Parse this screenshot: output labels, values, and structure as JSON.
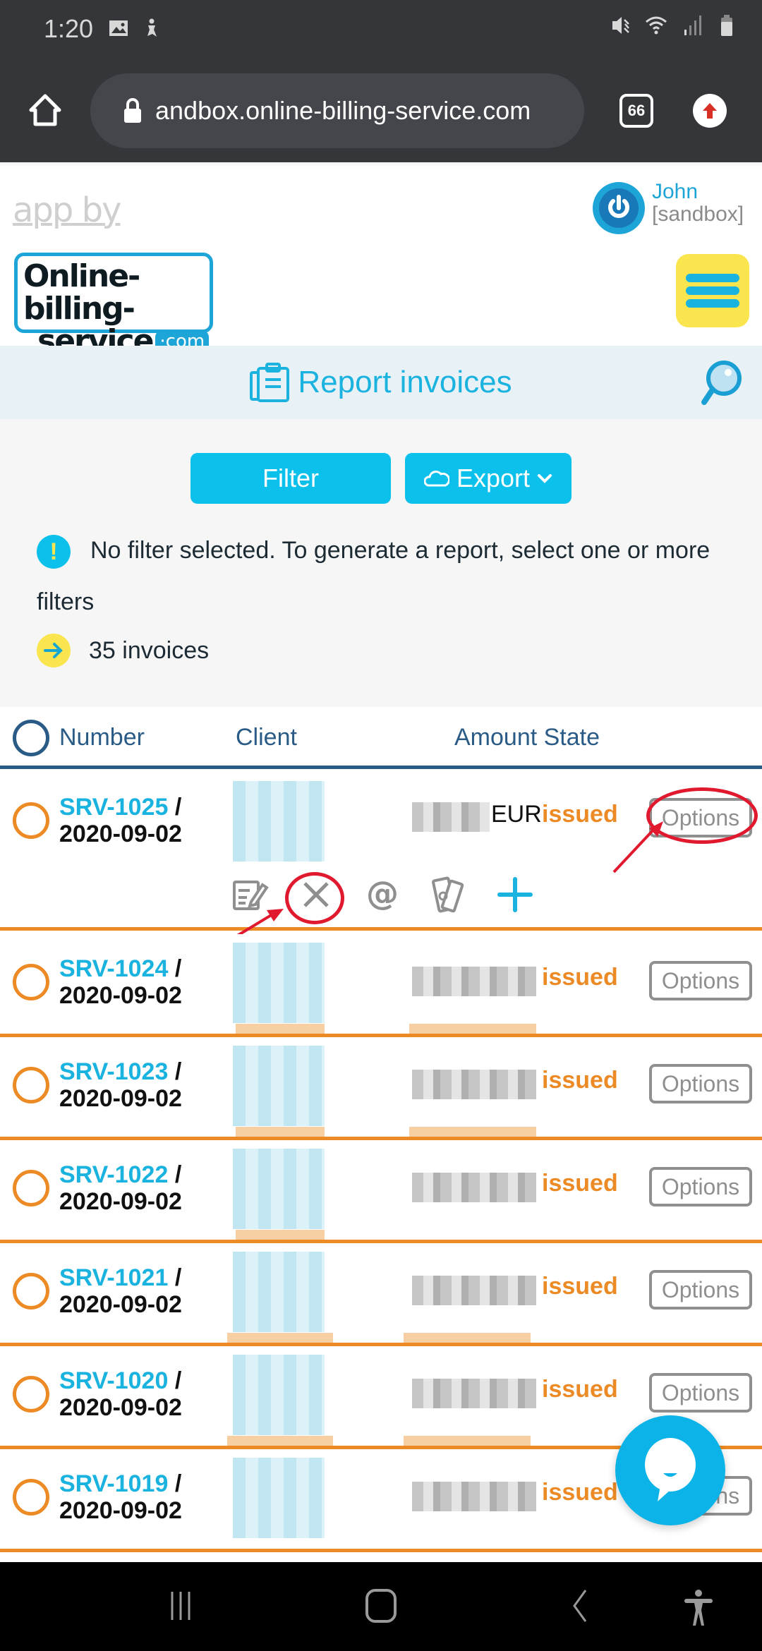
{
  "status_bar": {
    "time": "1:20",
    "left_icons": [
      "image-icon",
      "accessibility-notification-icon"
    ],
    "right_icons": [
      "vibrate-mute-icon",
      "wifi-icon",
      "signal-icon",
      "battery-icon"
    ]
  },
  "browser": {
    "url": "andbox.online-billing-service.com",
    "tab_count": "66",
    "home_icon": "home-icon",
    "lock_icon": "lock-icon",
    "update_icon": "update-arrow-icon"
  },
  "header": {
    "app_by": "app by",
    "logo_line1": "Online-billing-",
    "logo_line2": "service",
    "logo_com": "·com",
    "user_name": "John",
    "user_sub": "[sandbox]",
    "menu_icon": "hamburger-menu-icon"
  },
  "page": {
    "title": "Report invoices",
    "title_icon": "clipboard-icon",
    "search_icon": "search-icon"
  },
  "filters": {
    "filter_label": "Filter",
    "export_label": "Export",
    "notice_first": "No filter selected. To generate a report, select one or more",
    "notice_second": "filters",
    "count_text": "35 invoices"
  },
  "table": {
    "headers": {
      "number": "Number",
      "client": "Client",
      "amount_state": "Amount State"
    },
    "rows": [
      {
        "number": "SRV-1025",
        "sep": " /",
        "date": "2020-09-02",
        "currency": "EUR",
        "state": "issued",
        "options": "Options"
      },
      {
        "number": "SRV-1024",
        "sep": " /",
        "date": "2020-09-02",
        "currency": "",
        "state": "issued",
        "options": "Options"
      },
      {
        "number": "SRV-1023",
        "sep": " /",
        "date": "2020-09-02",
        "currency": "",
        "state": "issued",
        "options": "Options"
      },
      {
        "number": "SRV-1022",
        "sep": " /",
        "date": "2020-09-02",
        "currency": "",
        "state": "issued",
        "options": "Options"
      },
      {
        "number": "SRV-1021",
        "sep": " /",
        "date": "2020-09-02",
        "currency": "",
        "state": "issued",
        "options": "Options"
      },
      {
        "number": "SRV-1020",
        "sep": " /",
        "date": "2020-09-02",
        "currency": "",
        "state": "issued",
        "options": "Options"
      },
      {
        "number": "SRV-1019",
        "sep": " /",
        "date": "2020-09-02",
        "currency": "",
        "state": "issued",
        "options": "Options"
      }
    ],
    "row_actions": [
      "edit-icon",
      "cancel-icon",
      "email-icon",
      "payment-icon",
      "add-icon"
    ]
  },
  "colors": {
    "accent_blue": "#1ab3e0",
    "button_blue": "#0bc0ea",
    "header_navy": "#2a5b86",
    "state_orange": "#ec8a25",
    "menu_yellow": "#fbe54f",
    "annotation_red": "#e0192f"
  },
  "chat": {
    "icon": "chat-bubble-icon"
  },
  "navbar": {
    "icons": [
      "recent-apps-icon",
      "home-button-icon",
      "back-icon",
      "accessibility-icon"
    ]
  }
}
